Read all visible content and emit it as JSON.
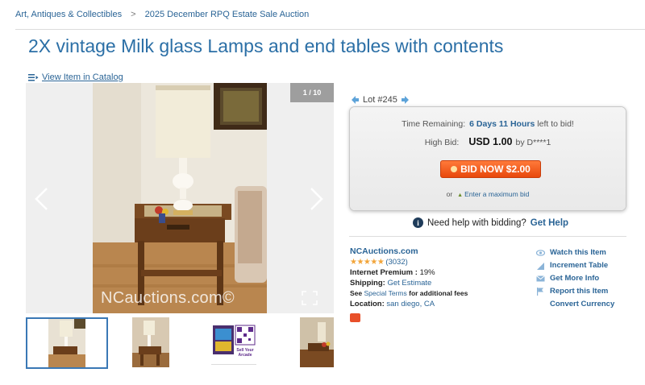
{
  "breadcrumb": {
    "items": [
      "Art, Antiques & Collectibles",
      "2025 December RPQ Estate Sale Auction"
    ],
    "separator": ">"
  },
  "item": {
    "title": "2X vintage Milk glass Lamps and end tables with contents",
    "catalog_link": "View Item in Catalog"
  },
  "gallery": {
    "counter": "1 / 10",
    "watermark": "NCauctions.com©",
    "thumbnail_count": 4,
    "qr_card_text": [
      "Sell Your",
      "Arcade"
    ]
  },
  "lot": {
    "label": "Lot #245"
  },
  "bidding": {
    "time_label": "Time Remaining:",
    "time_value": "6 Days 11 Hours",
    "time_suffix": "left to bid!",
    "high_bid_label": "High Bid:",
    "high_bid_amount": "USD 1.00",
    "high_bidder": "by D****1",
    "bid_now_label": "BID NOW $2.00",
    "max_prefix": "or",
    "max_link": "Enter a maximum bid"
  },
  "help": {
    "text": "Need help with bidding?",
    "link": "Get Help"
  },
  "seller": {
    "name": "NCAuctions.com",
    "stars": "★★★★★",
    "rating_count": "(3032)",
    "premium_label": "Internet Premium :",
    "premium_value": "19%",
    "shipping_label": "Shipping:",
    "shipping_link": "Get Estimate",
    "see_label": "See",
    "terms_link": "Special Terms",
    "terms_suffix": "for additional fees",
    "location_label": "Location:",
    "location_value": "san diego, CA"
  },
  "actions": {
    "items": [
      {
        "label": "Watch this Item",
        "icon": "eye-icon"
      },
      {
        "label": "Increment Table",
        "icon": "increment-icon"
      },
      {
        "label": "Get More Info",
        "icon": "mail-icon"
      },
      {
        "label": "Report this Item",
        "icon": "flag-icon"
      },
      {
        "label": "Convert Currency",
        "icon": "none"
      }
    ]
  },
  "colors": {
    "link": "#2a6496",
    "title": "#2b6fa6",
    "bid_button": "#f2551a",
    "stars": "#f2a53a"
  }
}
